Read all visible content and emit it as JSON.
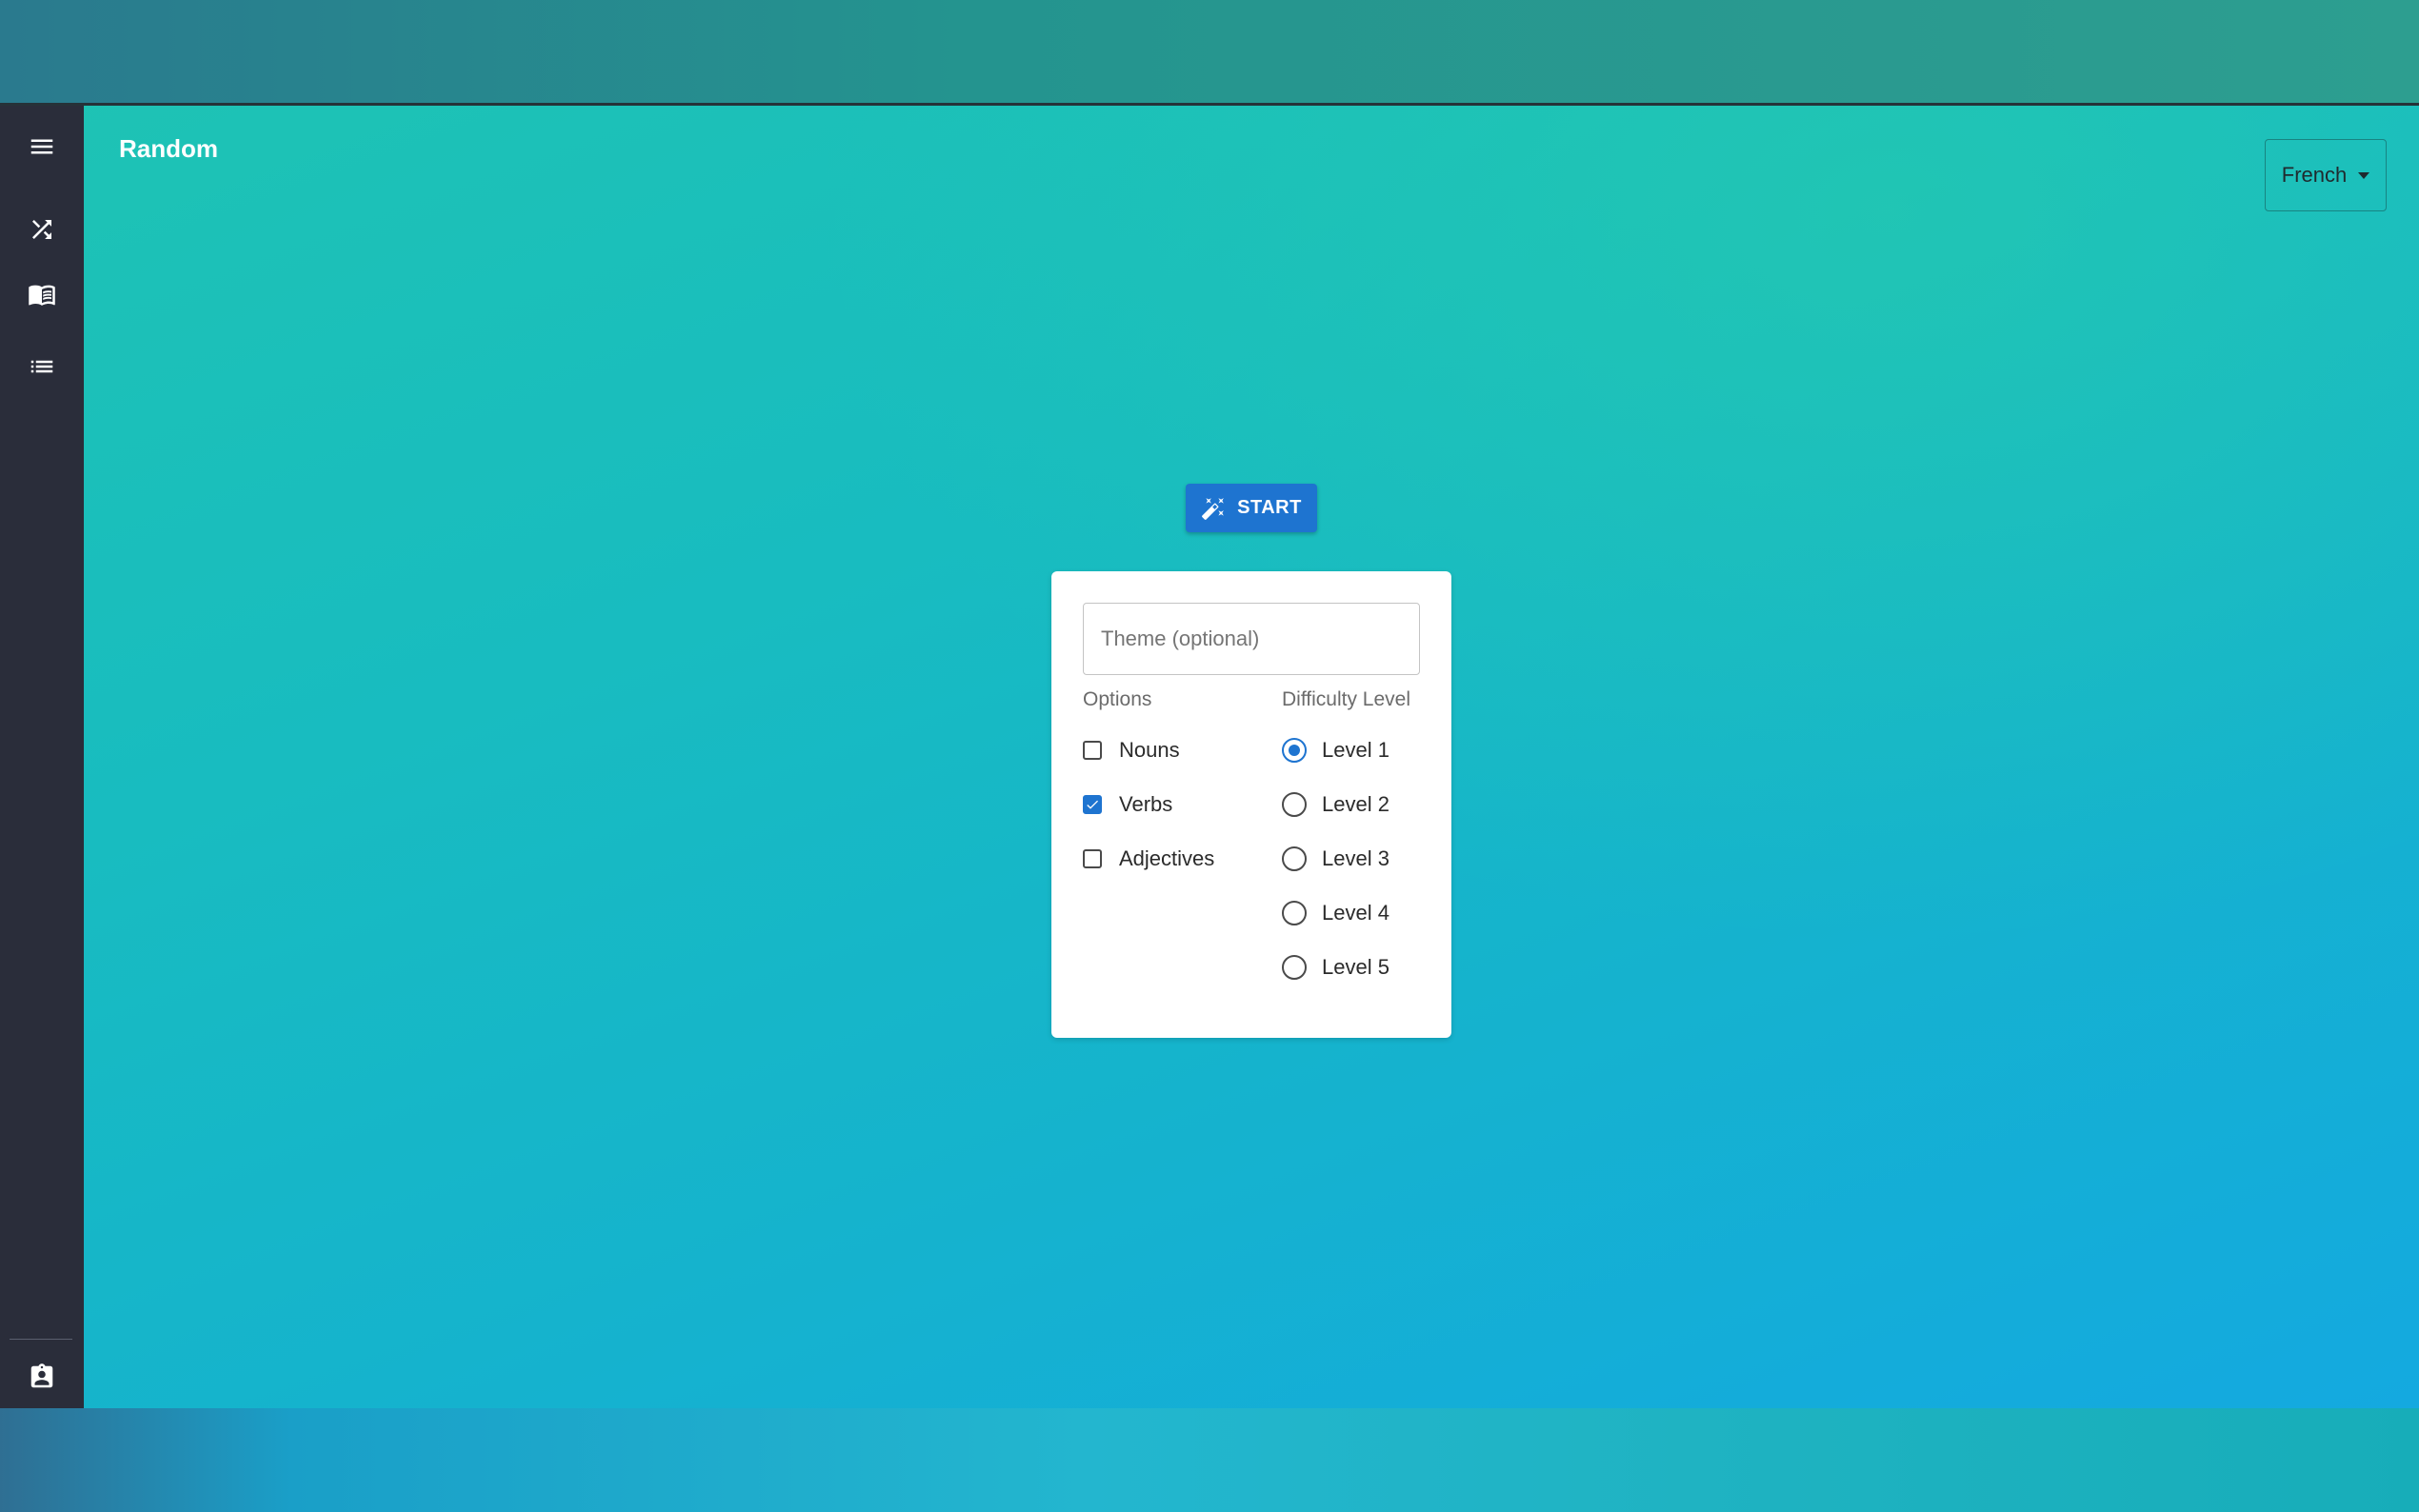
{
  "header": {
    "title": "Random",
    "language_select": {
      "value": "French"
    }
  },
  "sidebar": {
    "items": [
      {
        "icon": "menu-icon"
      },
      {
        "icon": "shuffle-icon"
      },
      {
        "icon": "book-icon"
      },
      {
        "icon": "list-icon"
      },
      {
        "icon": "contact-badge-icon"
      }
    ]
  },
  "main": {
    "start_label": "START",
    "theme_placeholder": "Theme (optional)",
    "options_label": "Options",
    "options": [
      {
        "label": "Nouns",
        "checked": false
      },
      {
        "label": "Verbs",
        "checked": true
      },
      {
        "label": "Adjectives",
        "checked": false
      }
    ],
    "difficulty_label": "Difficulty Level",
    "levels": [
      {
        "label": "Level 1",
        "selected": true
      },
      {
        "label": "Level 2",
        "selected": false
      },
      {
        "label": "Level 3",
        "selected": false
      },
      {
        "label": "Level 4",
        "selected": false
      },
      {
        "label": "Level 5",
        "selected": false
      }
    ]
  },
  "colors": {
    "accent": "#1e74d0",
    "sidebar": "#2a2d3a",
    "background_teal": "#1ec3b4",
    "background_blue": "#14a9e0"
  }
}
